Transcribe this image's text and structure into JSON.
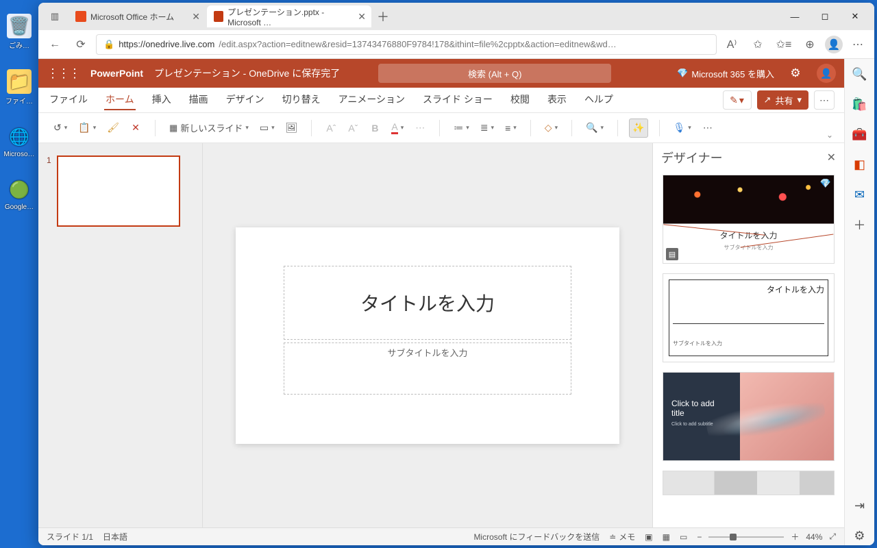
{
  "desktop": {
    "icons": [
      "ごみ…",
      "ファイ…",
      "Microso…",
      "Google…"
    ]
  },
  "browser": {
    "tabs": [
      {
        "label": "Microsoft Office ホーム"
      },
      {
        "label": "プレゼンテーション.pptx - Microsoft …"
      }
    ],
    "url_host": "https://onedrive.live.com",
    "url_rest": "/edit.aspx?action=editnew&resid=13743476880F9784!178&ithint=file%2cpptx&action=editnew&wd…"
  },
  "titlebar": {
    "app": "PowerPoint",
    "doc": "プレゼンテーション",
    "saved": " - OneDrive に保存完了",
    "search": "検索 (Alt + Q)",
    "buy": "Microsoft 365 を購入"
  },
  "ribbon_tabs": [
    "ファイル",
    "ホーム",
    "挿入",
    "描画",
    "デザイン",
    "切り替え",
    "アニメーション",
    "スライド ショー",
    "校閲",
    "表示",
    "ヘルプ"
  ],
  "share": "共有",
  "toolbar": {
    "newslide": "新しいスライド"
  },
  "slide": {
    "title": "タイトルを入力",
    "subtitle": "サブタイトルを入力"
  },
  "thumb": {
    "num": "1"
  },
  "designer": {
    "title": "デザイナー",
    "idea1_title": "タイトルを入力",
    "idea1_sub": "サブタイトルを入力",
    "idea2_title": "タイトルを入力",
    "idea2_sub": "サブタイトルを入力",
    "idea3_title": "Click to add title",
    "idea3_sub": "Click to add subtitle"
  },
  "status": {
    "slide": "スライド 1/1",
    "lang": "日本語",
    "feedback": "Microsoft にフィードバックを送信",
    "notes": "メモ",
    "zoom": "44%"
  }
}
